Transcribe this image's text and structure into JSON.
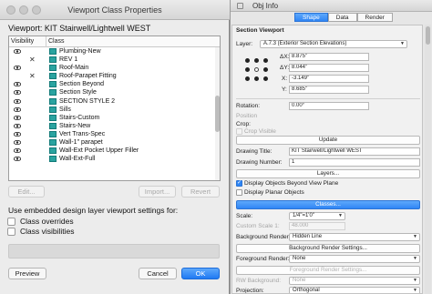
{
  "dialog": {
    "title": "Viewport Class Properties",
    "viewport_label": "Viewport:  KIT Stairwell/Lightwell WEST",
    "columns": [
      "Visibility",
      "Class"
    ],
    "rows": [
      {
        "visible": true,
        "name": "Plumbing-New"
      },
      {
        "visible": false,
        "name": "REV 1"
      },
      {
        "visible": true,
        "name": "Roof-Main"
      },
      {
        "visible": false,
        "name": "Roof-Parapet Fitting"
      },
      {
        "visible": true,
        "name": "Section Beyond"
      },
      {
        "visible": true,
        "name": "Section Style"
      },
      {
        "visible": true,
        "name": "SECTION STYLE 2"
      },
      {
        "visible": true,
        "name": "Sills"
      },
      {
        "visible": true,
        "name": "Stairs-Custom"
      },
      {
        "visible": true,
        "name": "Stairs-New"
      },
      {
        "visible": true,
        "name": "Vert Trans-Spec"
      },
      {
        "visible": true,
        "name": "Wall-1\" parapet"
      },
      {
        "visible": true,
        "name": "Wall-Ext Pocket Upper Filler"
      },
      {
        "visible": true,
        "name": "Wall-Ext-Full"
      }
    ],
    "scroll_position": 0.5,
    "edit_label": "Edit...",
    "import_label": "Import...",
    "revert_label": "Revert",
    "use_embedded_label": "Use embedded design layer viewport settings for:",
    "class_overrides_label": "Class overrides",
    "class_visibilities_label": "Class visibilities",
    "preview_label": "Preview",
    "cancel_label": "Cancel",
    "ok_label": "OK"
  },
  "obj_info": {
    "title": "Obj Info",
    "tabs": [
      {
        "label": "Shape",
        "active": true
      },
      {
        "label": "Data",
        "active": false
      },
      {
        "label": "Render",
        "active": false
      }
    ],
    "section_title": "Section Viewport",
    "layer_label": "Layer:",
    "layer_value": "A.7.3 (Exterior Section Elevations)",
    "dx_label": "ΔX:",
    "dx_value": "8.875\"",
    "dy_label": "ΔY:",
    "dy_value": "8.044\"",
    "x_label": "X:",
    "x_value": "-3.149\"",
    "y_label": "Y:",
    "y_value": "8.685\"",
    "rotation_label": "Rotation:",
    "rotation_value": "0.00°",
    "position_label": "Position",
    "crop_label": "Crop:",
    "crop_visible_label": "Crop Visible",
    "update_label": "Update",
    "drawing_title_label": "Drawing Title:",
    "drawing_title_value": "KIT Stairwell/Lightwell WEST",
    "drawing_number_label": "Drawing Number:",
    "drawing_number_value": "1",
    "layers_label": "Layers...",
    "display_beyond_label": "Display Objects Beyond View Plane",
    "display_planar_label": "Display Planar Objects",
    "classes_label": "Classes...",
    "scale_label": "Scale:",
    "scale_value": "1/4\"=1'0\"",
    "custom_scale_label": "Custom Scale 1:",
    "custom_scale_value": "48.000",
    "bg_render_label": "Background Render:",
    "bg_render_value": "Hidden Line",
    "bg_render_settings_label": "Background Render Settings...",
    "fg_render_label": "Foreground Render:",
    "fg_render_value": "None",
    "fg_render_settings_label": "Foreground Render Settings...",
    "rw_background_label": "RW Background:",
    "rw_background_value": "None",
    "projection_label": "Projection:",
    "projection_value": "Orthogonal",
    "colors": {
      "accent": "#2f86f5",
      "class_icon": "#2aa3a0"
    }
  }
}
